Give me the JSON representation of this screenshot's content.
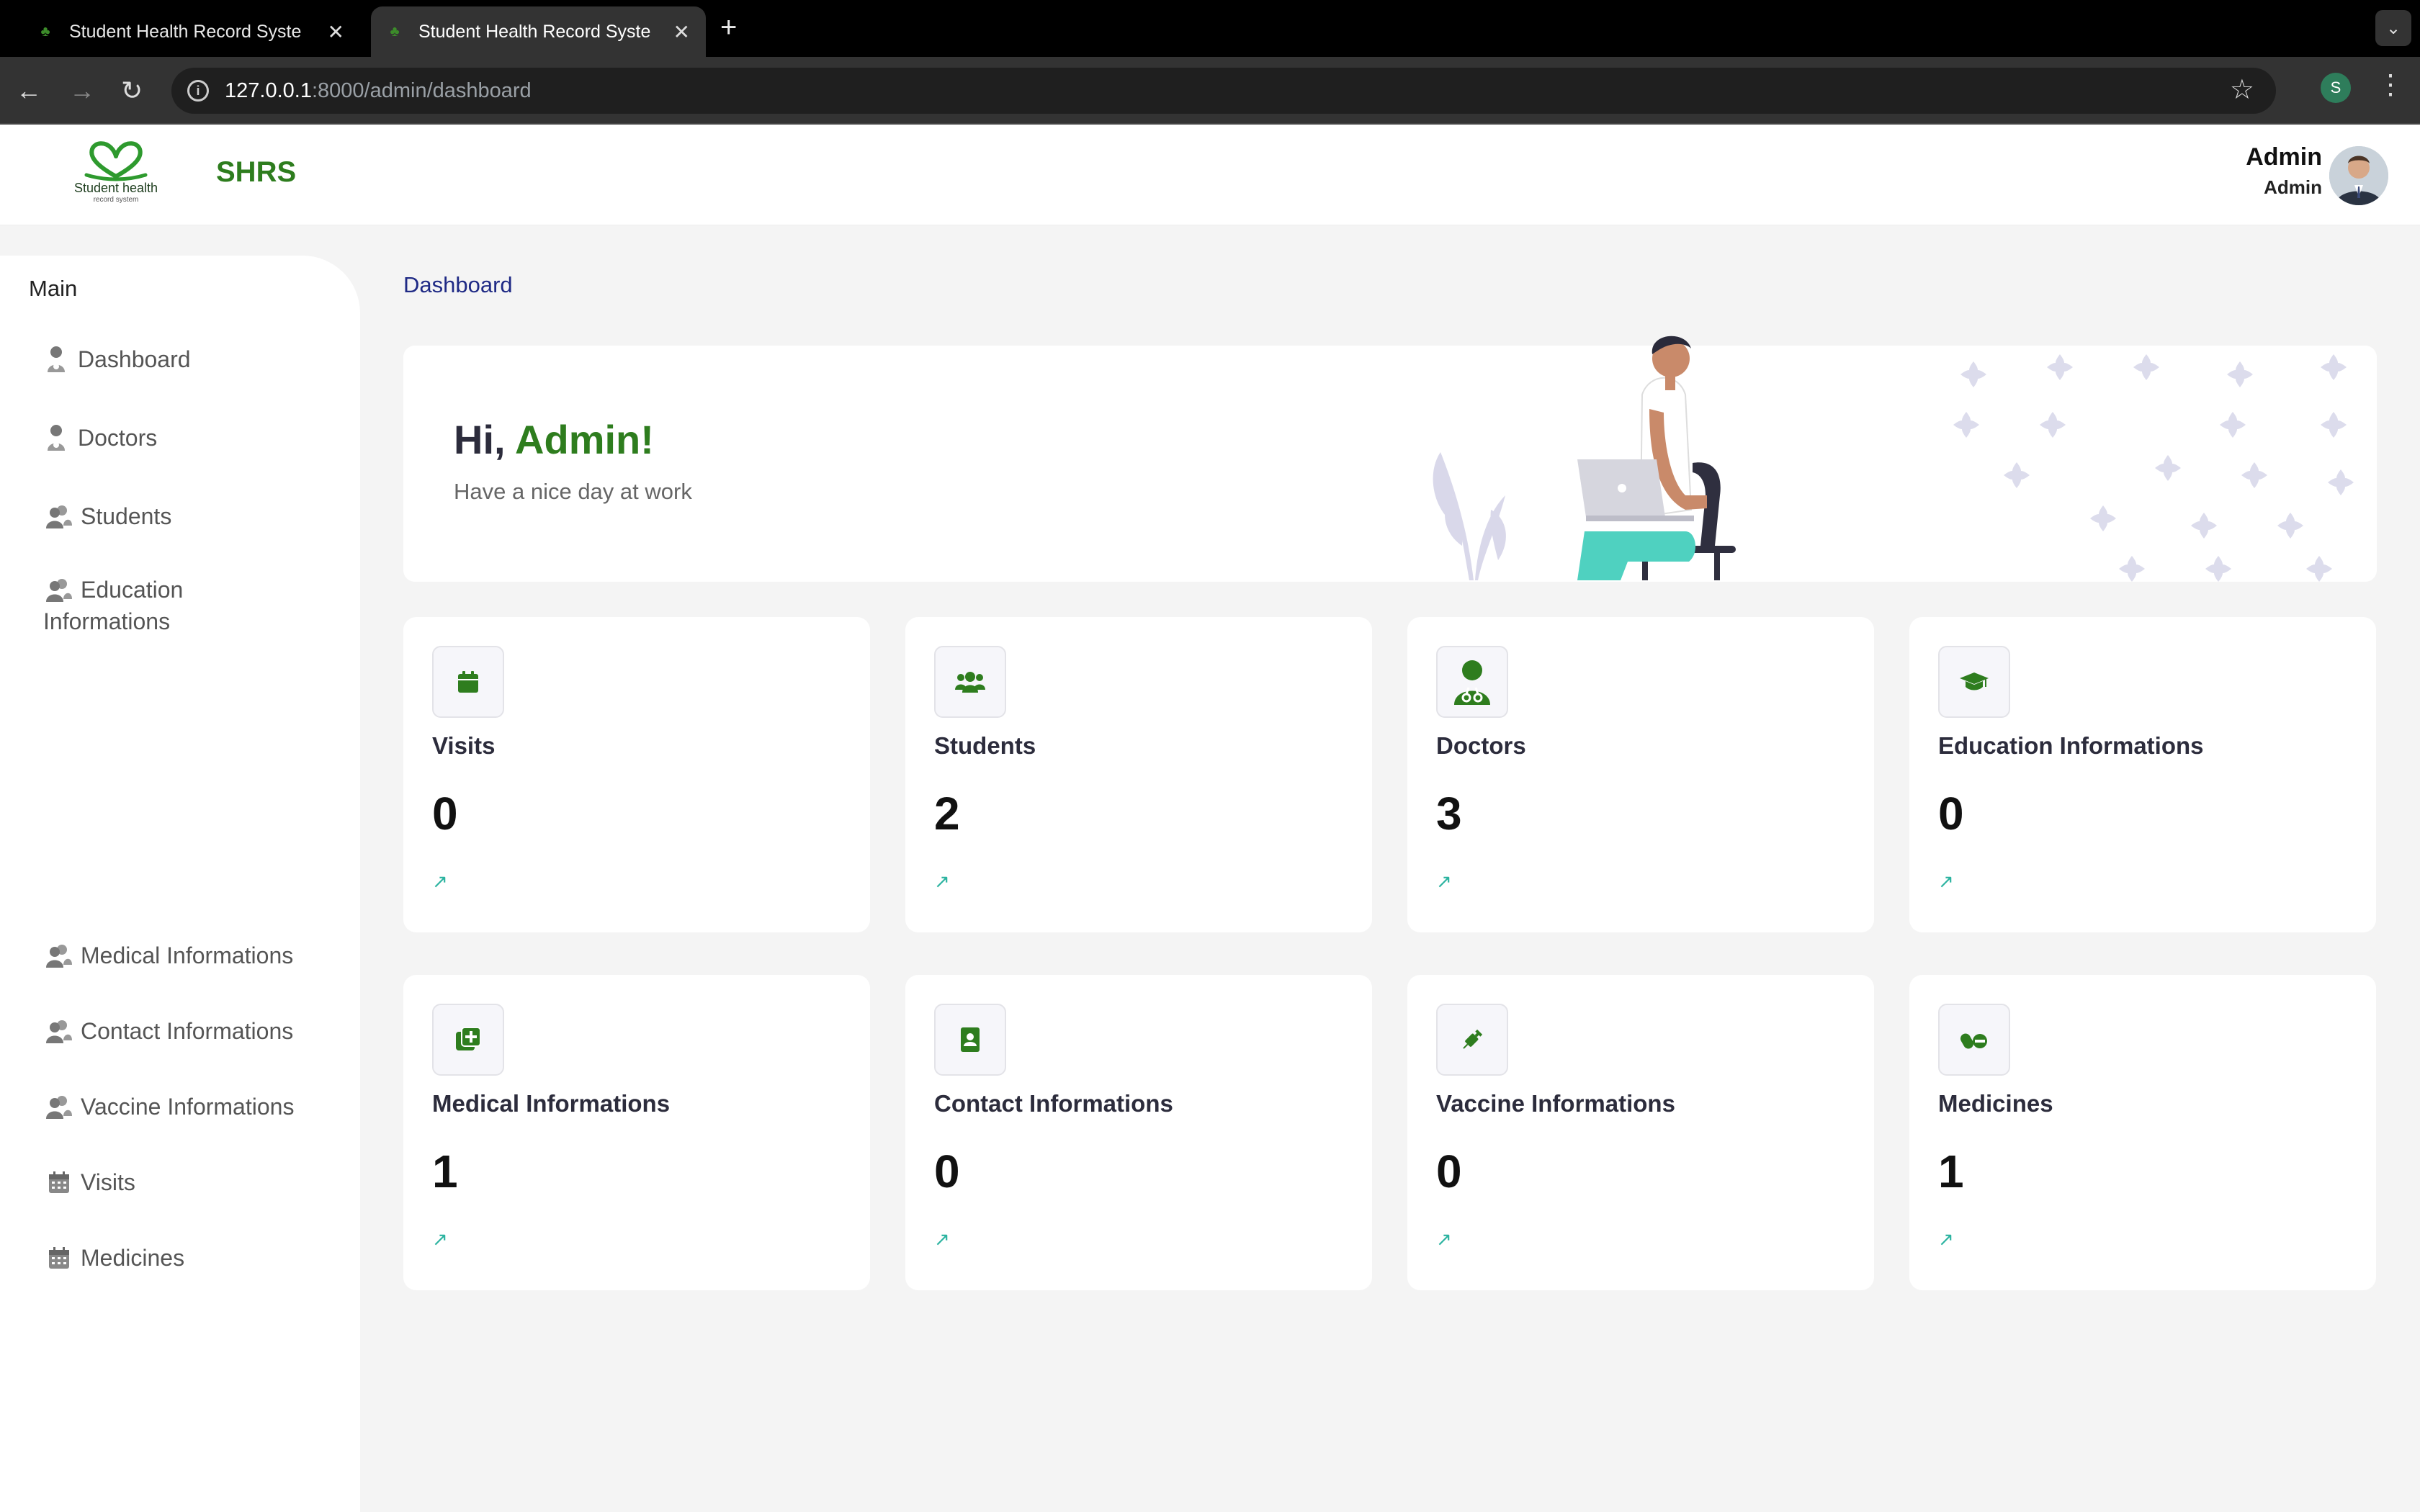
{
  "browser": {
    "tabs": [
      {
        "title": "Student Health Record Syste",
        "active": false
      },
      {
        "title": "Student Health Record Syste",
        "active": true
      }
    ],
    "url_host": "127.0.0.1",
    "url_path": ":8000/admin/dashboard",
    "profile_initial": "S"
  },
  "header": {
    "logo_line1": "Student health",
    "logo_line2": "record system",
    "brand": "SHRS",
    "user_name": "Admin",
    "user_role": "Admin"
  },
  "sidebar": {
    "section": "Main",
    "items": [
      {
        "label": "Dashboard",
        "icon": "user-icon"
      },
      {
        "label": "Doctors",
        "icon": "user-icon"
      },
      {
        "label": "Students",
        "icon": "users-icon"
      },
      {
        "label": "Education\nInformations",
        "icon": "users-icon"
      },
      {
        "label": "Medical Informations",
        "icon": "users-icon"
      },
      {
        "label": "Contact Informations",
        "icon": "users-icon"
      },
      {
        "label": "Vaccine Informations",
        "icon": "users-icon"
      },
      {
        "label": "Visits",
        "icon": "calendar-icon"
      },
      {
        "label": "Medicines",
        "icon": "calendar-icon"
      }
    ]
  },
  "main": {
    "breadcrumb": "Dashboard",
    "greeting_prefix": "Hi, ",
    "greeting_name": "Admin!",
    "greeting_sub": "Have a nice day at work",
    "cards": [
      {
        "label": "Visits",
        "value": "0",
        "icon": "calendar-icon"
      },
      {
        "label": "Students",
        "value": "2",
        "icon": "users-icon"
      },
      {
        "label": "Doctors",
        "value": "3",
        "icon": "doctor-icon"
      },
      {
        "label": "Education Informations",
        "value": "0",
        "icon": "graduation-cap-icon"
      },
      {
        "label": "Medical Informations",
        "value": "1",
        "icon": "medical-plus-icon"
      },
      {
        "label": "Contact Informations",
        "value": "0",
        "icon": "contact-book-icon"
      },
      {
        "label": "Vaccine Informations",
        "value": "0",
        "icon": "syringe-icon"
      },
      {
        "label": "Medicines",
        "value": "1",
        "icon": "pills-icon"
      }
    ]
  },
  "colors": {
    "brand_green": "#2e7d1e",
    "breadcrumb_blue": "#1f2a85",
    "arrow_teal": "#2bb3a0"
  }
}
